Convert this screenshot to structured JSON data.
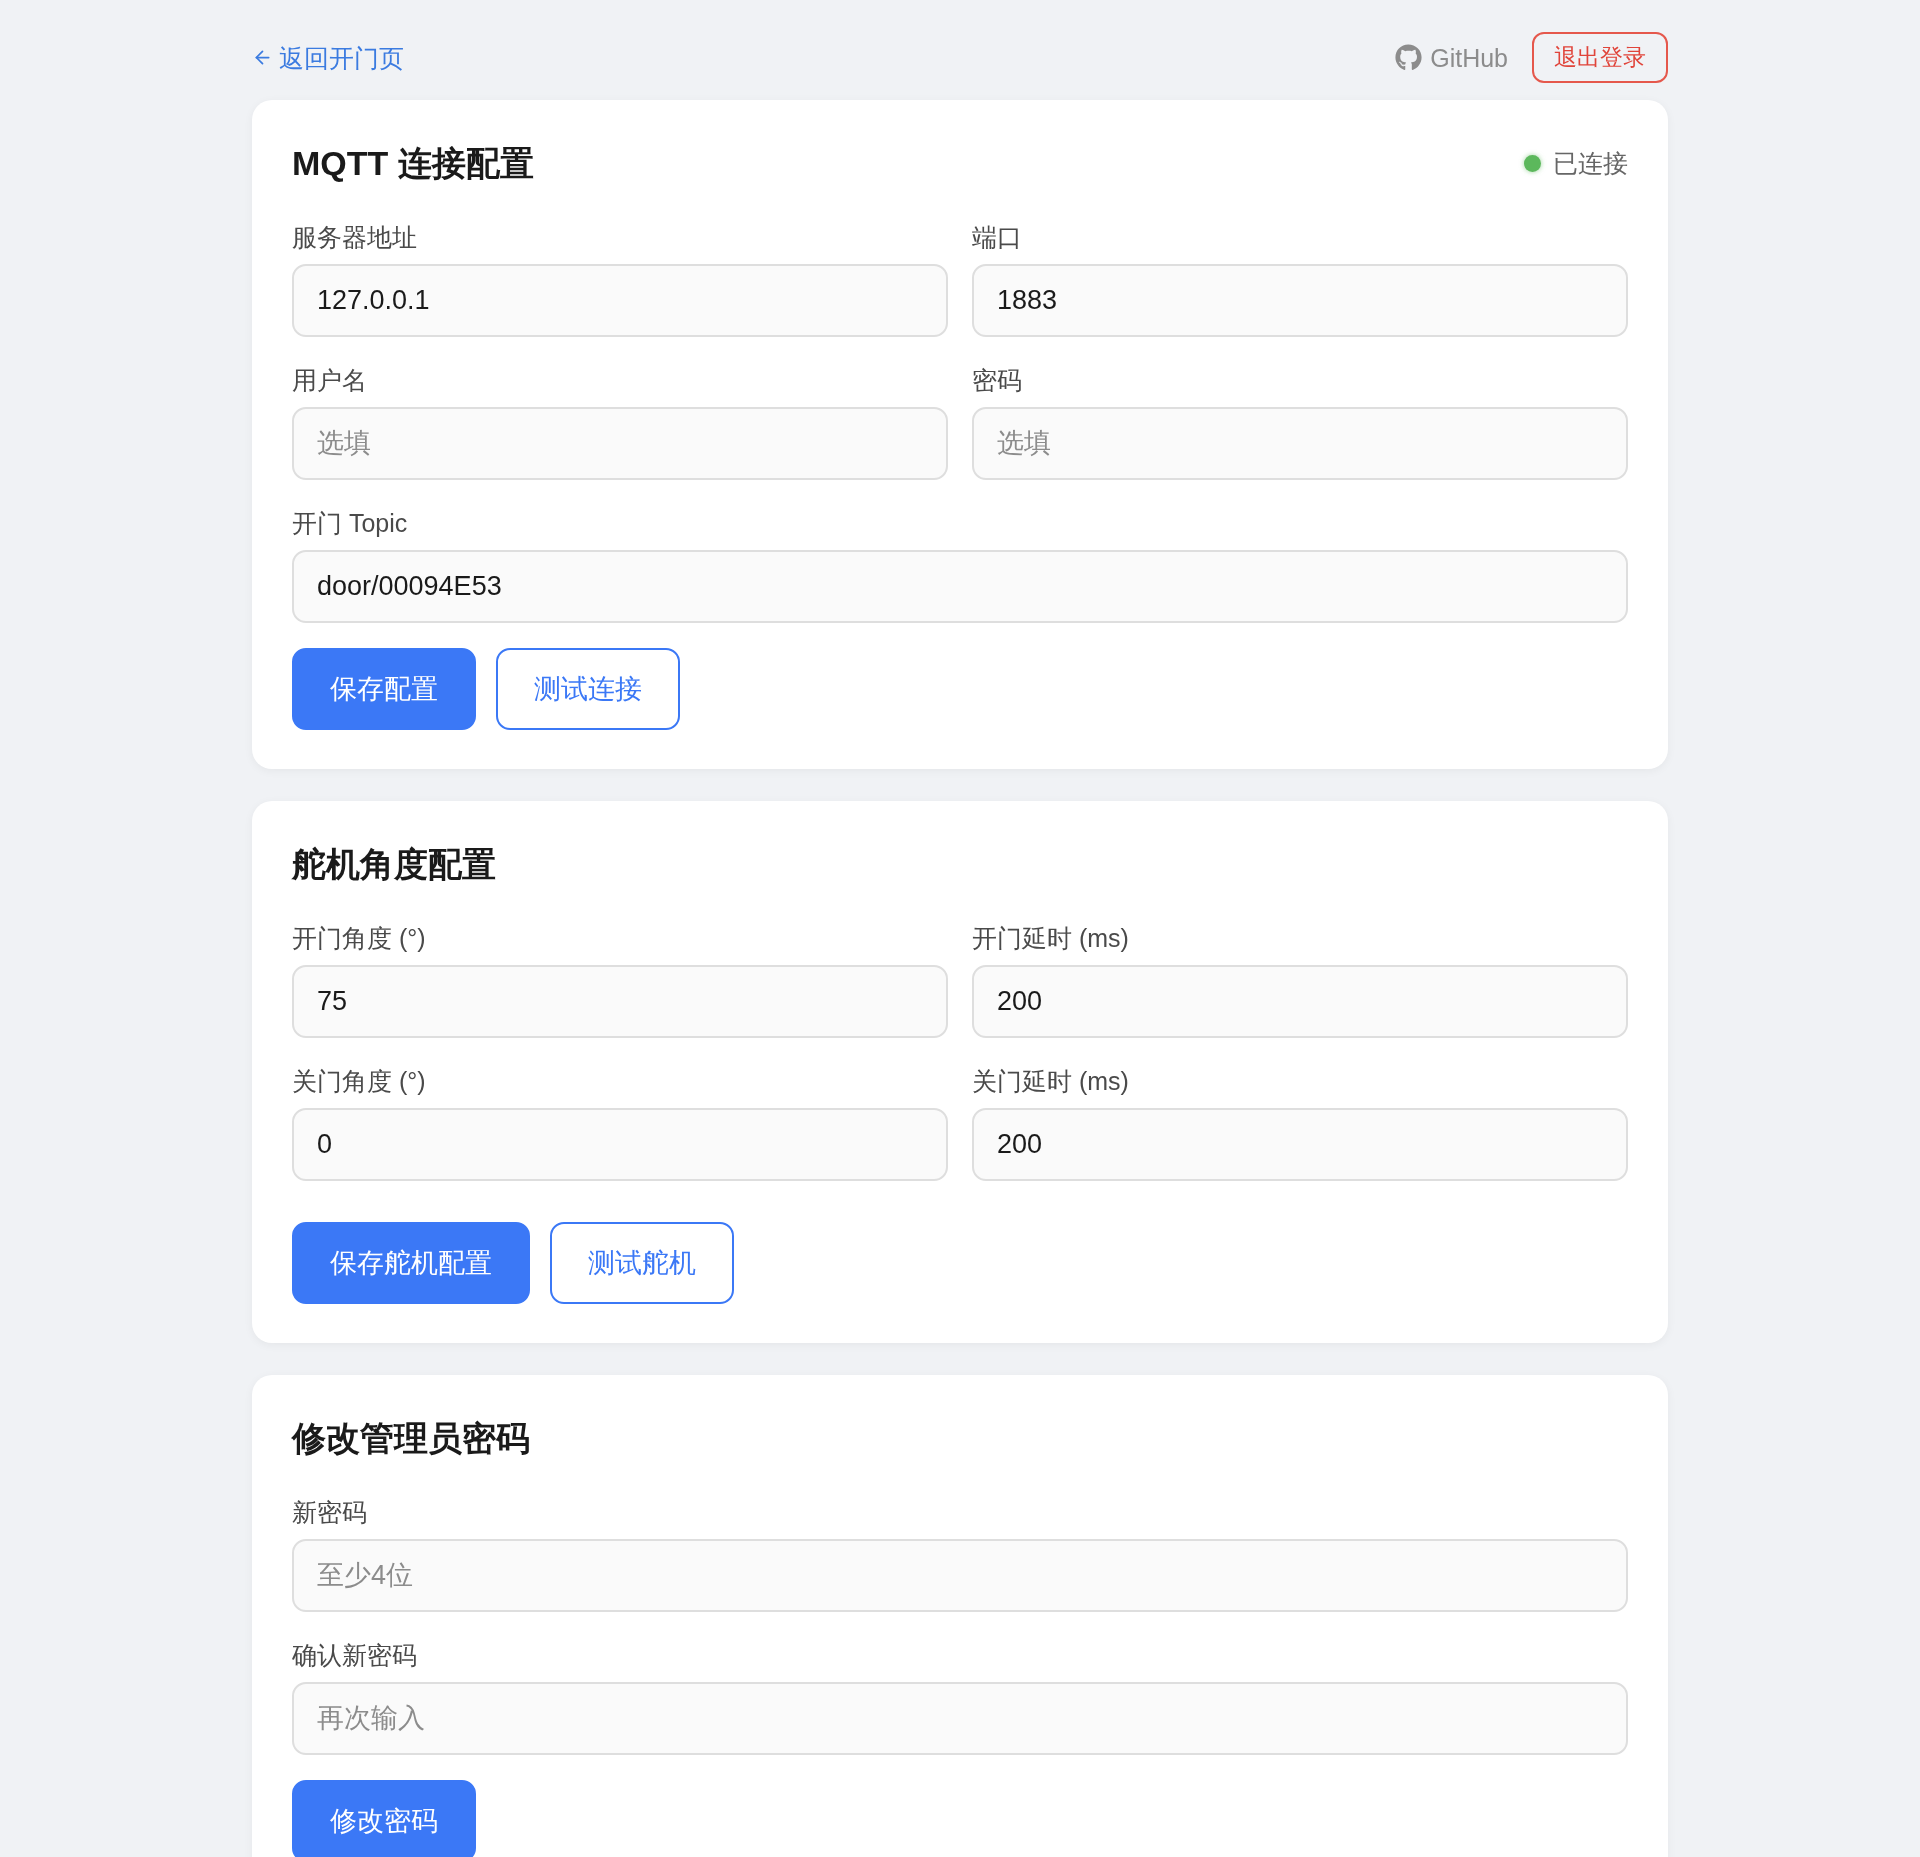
{
  "top_bar": {
    "back_link": "返回开门页",
    "github_link": "GitHub",
    "logout_button": "退出登录"
  },
  "sections": [
    {
      "title": "MQTT 连接配置",
      "status": {
        "label": "已连接",
        "connected": true
      },
      "rows": [
        [
          {
            "label": "服务器地址",
            "value": "127.0.0.1"
          },
          {
            "label": "端口",
            "value": "1883"
          }
        ],
        [
          {
            "label": "用户名",
            "placeholder": "选填"
          },
          {
            "label": "密码",
            "placeholder": "选填"
          }
        ],
        [
          {
            "label": "开门 Topic",
            "value": "door/00094E53"
          }
        ]
      ],
      "buttons": [
        {
          "label": "保存配置",
          "kind": "primary"
        },
        {
          "label": "测试连接",
          "kind": "outline"
        }
      ]
    },
    {
      "title": "舵机角度配置",
      "rows": [
        [
          {
            "label": "开门角度 (°)",
            "value": "75"
          },
          {
            "label": "开门延时 (ms)",
            "value": "200"
          }
        ],
        [
          {
            "label": "关门角度 (°)",
            "value": "0"
          },
          {
            "label": "关门延时 (ms)",
            "value": "200"
          }
        ]
      ],
      "buttons": [
        {
          "label": "保存舵机配置",
          "kind": "primary"
        },
        {
          "label": "测试舵机",
          "kind": "outline"
        }
      ]
    },
    {
      "title": "修改管理员密码",
      "rows": [
        [
          {
            "label": "新密码",
            "placeholder": "至少4位"
          }
        ],
        [
          {
            "label": "确认新密码",
            "placeholder": "再次输入"
          }
        ]
      ],
      "buttons": [
        {
          "label": "修改密码",
          "kind": "primary"
        }
      ]
    }
  ]
}
